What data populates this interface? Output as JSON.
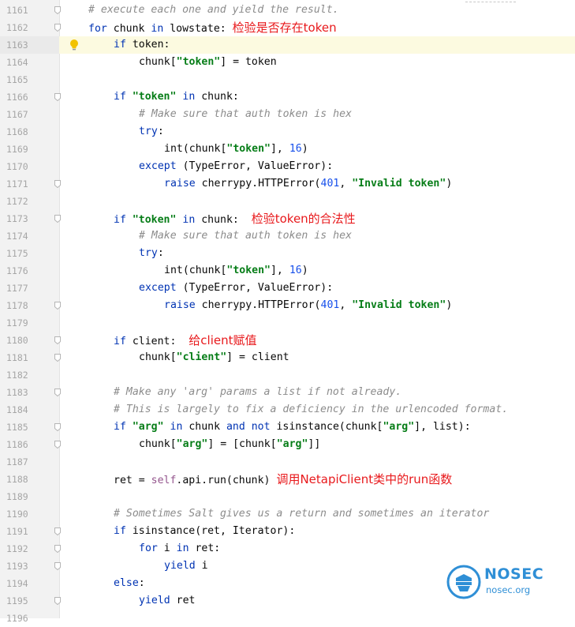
{
  "editor": {
    "current_line": "1163",
    "lines": [
      {
        "n": "1161",
        "fold": true,
        "indent": 1,
        "tokens": [
          {
            "c": "cm",
            "t": "# execute each one and yield the result."
          }
        ]
      },
      {
        "n": "1162",
        "fold": true,
        "indent": 1,
        "tokens": [
          {
            "c": "kw",
            "t": "for"
          },
          {
            "c": "",
            "t": " chunk "
          },
          {
            "c": "kw",
            "t": "in"
          },
          {
            "c": "",
            "t": " lowstate: "
          },
          {
            "c": "ann",
            "t": "检验是否存在token"
          }
        ]
      },
      {
        "n": "1163",
        "fold": false,
        "bulb": true,
        "indent": 2,
        "tokens": [
          {
            "c": "kw",
            "t": "if"
          },
          {
            "c": "",
            "t": " token:"
          }
        ]
      },
      {
        "n": "1164",
        "fold": false,
        "indent": 3,
        "tokens": [
          {
            "c": "",
            "t": "chunk["
          },
          {
            "c": "str",
            "t": "\"token\""
          },
          {
            "c": "",
            "t": "] = token"
          }
        ]
      },
      {
        "n": "1165",
        "fold": false,
        "indent": 0,
        "tokens": []
      },
      {
        "n": "1166",
        "fold": true,
        "indent": 2,
        "tokens": [
          {
            "c": "kw",
            "t": "if"
          },
          {
            "c": "",
            "t": " "
          },
          {
            "c": "str",
            "t": "\"token\""
          },
          {
            "c": "",
            "t": " "
          },
          {
            "c": "kw",
            "t": "in"
          },
          {
            "c": "",
            "t": " chunk:"
          }
        ]
      },
      {
        "n": "1167",
        "fold": false,
        "indent": 3,
        "tokens": [
          {
            "c": "cm",
            "t": "# Make sure that auth token is hex"
          }
        ]
      },
      {
        "n": "1168",
        "fold": false,
        "indent": 3,
        "tokens": [
          {
            "c": "kw",
            "t": "try"
          },
          {
            "c": "",
            "t": ":"
          }
        ]
      },
      {
        "n": "1169",
        "fold": false,
        "indent": 4,
        "tokens": [
          {
            "c": "",
            "t": "int(chunk["
          },
          {
            "c": "str",
            "t": "\"token\""
          },
          {
            "c": "",
            "t": "], "
          },
          {
            "c": "num",
            "t": "16"
          },
          {
            "c": "",
            "t": ")"
          }
        ]
      },
      {
        "n": "1170",
        "fold": false,
        "indent": 3,
        "tokens": [
          {
            "c": "kw",
            "t": "except"
          },
          {
            "c": "",
            "t": " (TypeError, ValueError):"
          }
        ]
      },
      {
        "n": "1171",
        "fold": true,
        "indent": 4,
        "tokens": [
          {
            "c": "kw",
            "t": "raise"
          },
          {
            "c": "",
            "t": " cherrypy.HTTPError("
          },
          {
            "c": "num",
            "t": "401"
          },
          {
            "c": "",
            "t": ", "
          },
          {
            "c": "str",
            "t": "\"Invalid token\""
          },
          {
            "c": "",
            "t": ")"
          }
        ]
      },
      {
        "n": "1172",
        "fold": false,
        "indent": 0,
        "tokens": []
      },
      {
        "n": "1173",
        "fold": true,
        "indent": 2,
        "tokens": [
          {
            "c": "kw",
            "t": "if"
          },
          {
            "c": "",
            "t": " "
          },
          {
            "c": "str",
            "t": "\"token\""
          },
          {
            "c": "",
            "t": " "
          },
          {
            "c": "kw",
            "t": "in"
          },
          {
            "c": "",
            "t": " chunk:  "
          },
          {
            "c": "ann",
            "t": "检验token的合法性"
          }
        ]
      },
      {
        "n": "1174",
        "fold": false,
        "indent": 3,
        "tokens": [
          {
            "c": "cm",
            "t": "# Make sure that auth token is hex"
          }
        ]
      },
      {
        "n": "1175",
        "fold": false,
        "indent": 3,
        "tokens": [
          {
            "c": "kw",
            "t": "try"
          },
          {
            "c": "",
            "t": ":"
          }
        ]
      },
      {
        "n": "1176",
        "fold": false,
        "indent": 4,
        "tokens": [
          {
            "c": "",
            "t": "int(chunk["
          },
          {
            "c": "str",
            "t": "\"token\""
          },
          {
            "c": "",
            "t": "], "
          },
          {
            "c": "num",
            "t": "16"
          },
          {
            "c": "",
            "t": ")"
          }
        ]
      },
      {
        "n": "1177",
        "fold": false,
        "indent": 3,
        "tokens": [
          {
            "c": "kw",
            "t": "except"
          },
          {
            "c": "",
            "t": " (TypeError, ValueError):"
          }
        ]
      },
      {
        "n": "1178",
        "fold": true,
        "indent": 4,
        "tokens": [
          {
            "c": "kw",
            "t": "raise"
          },
          {
            "c": "",
            "t": " cherrypy.HTTPError("
          },
          {
            "c": "num",
            "t": "401"
          },
          {
            "c": "",
            "t": ", "
          },
          {
            "c": "str",
            "t": "\"Invalid token\""
          },
          {
            "c": "",
            "t": ")"
          }
        ]
      },
      {
        "n": "1179",
        "fold": false,
        "indent": 0,
        "tokens": []
      },
      {
        "n": "1180",
        "fold": true,
        "indent": 2,
        "tokens": [
          {
            "c": "kw",
            "t": "if"
          },
          {
            "c": "",
            "t": " client:  "
          },
          {
            "c": "ann",
            "t": "给client赋值"
          }
        ]
      },
      {
        "n": "1181",
        "fold": true,
        "indent": 3,
        "tokens": [
          {
            "c": "",
            "t": "chunk["
          },
          {
            "c": "str",
            "t": "\"client\""
          },
          {
            "c": "",
            "t": "] = client"
          }
        ]
      },
      {
        "n": "1182",
        "fold": false,
        "indent": 0,
        "tokens": []
      },
      {
        "n": "1183",
        "fold": true,
        "indent": 2,
        "tokens": [
          {
            "c": "cm",
            "t": "# Make any 'arg' params a list if not already."
          }
        ]
      },
      {
        "n": "1184",
        "fold": false,
        "indent": 2,
        "tokens": [
          {
            "c": "cm",
            "t": "# This is largely to fix a deficiency in the urlencoded format."
          }
        ]
      },
      {
        "n": "1185",
        "fold": true,
        "indent": 2,
        "tokens": [
          {
            "c": "kw",
            "t": "if"
          },
          {
            "c": "",
            "t": " "
          },
          {
            "c": "str",
            "t": "\"arg\""
          },
          {
            "c": "",
            "t": " "
          },
          {
            "c": "kw",
            "t": "in"
          },
          {
            "c": "",
            "t": " chunk "
          },
          {
            "c": "kw",
            "t": "and not"
          },
          {
            "c": "",
            "t": " isinstance(chunk["
          },
          {
            "c": "str",
            "t": "\"arg\""
          },
          {
            "c": "",
            "t": "], list):"
          }
        ]
      },
      {
        "n": "1186",
        "fold": true,
        "indent": 3,
        "tokens": [
          {
            "c": "",
            "t": "chunk["
          },
          {
            "c": "str",
            "t": "\"arg\""
          },
          {
            "c": "",
            "t": "] = [chunk["
          },
          {
            "c": "str",
            "t": "\"arg\""
          },
          {
            "c": "",
            "t": "]]"
          }
        ]
      },
      {
        "n": "1187",
        "fold": false,
        "indent": 0,
        "tokens": []
      },
      {
        "n": "1188",
        "fold": false,
        "indent": 2,
        "tokens": [
          {
            "c": "",
            "t": "ret = "
          },
          {
            "c": "self",
            "t": "self"
          },
          {
            "c": "",
            "t": ".api.run(chunk) "
          },
          {
            "c": "ann",
            "t": "调用NetapiClient类中的run函数"
          }
        ]
      },
      {
        "n": "1189",
        "fold": false,
        "indent": 0,
        "tokens": []
      },
      {
        "n": "1190",
        "fold": false,
        "indent": 2,
        "tokens": [
          {
            "c": "cm",
            "t": "# Sometimes Salt gives us a return and sometimes an iterator"
          }
        ]
      },
      {
        "n": "1191",
        "fold": true,
        "indent": 2,
        "tokens": [
          {
            "c": "kw",
            "t": "if"
          },
          {
            "c": "",
            "t": " isinstance(ret, Iterator):"
          }
        ]
      },
      {
        "n": "1192",
        "fold": true,
        "indent": 3,
        "tokens": [
          {
            "c": "kw",
            "t": "for"
          },
          {
            "c": "",
            "t": " i "
          },
          {
            "c": "kw",
            "t": "in"
          },
          {
            "c": "",
            "t": " ret:"
          }
        ]
      },
      {
        "n": "1193",
        "fold": true,
        "indent": 4,
        "tokens": [
          {
            "c": "kw",
            "t": "yield"
          },
          {
            "c": "",
            "t": " i"
          }
        ]
      },
      {
        "n": "1194",
        "fold": false,
        "indent": 2,
        "tokens": [
          {
            "c": "kw",
            "t": "else"
          },
          {
            "c": "",
            "t": ":"
          }
        ]
      },
      {
        "n": "1195",
        "fold": true,
        "indent": 3,
        "tokens": [
          {
            "c": "kw",
            "t": "yield"
          },
          {
            "c": "",
            "t": " ret"
          }
        ]
      },
      {
        "n": "1196",
        "fold": false,
        "indent": 0,
        "tokens": []
      }
    ]
  },
  "watermark": {
    "name": "NOSEC",
    "url": "nosec.org",
    "color": "#2f8fd6"
  }
}
